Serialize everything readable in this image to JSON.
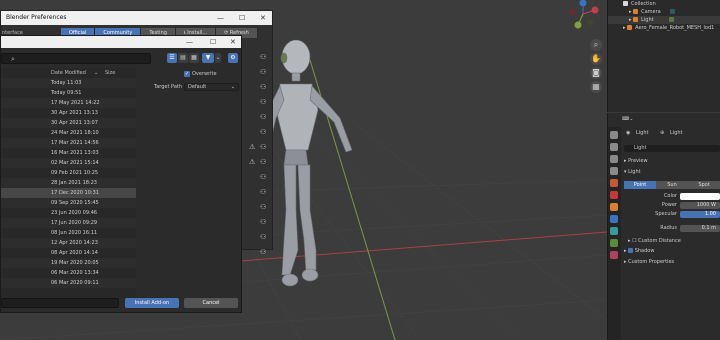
{
  "prefs_window": {
    "title": "Blender Preferences",
    "sidebar_label": "nterface",
    "tabs": [
      {
        "label": "Official",
        "active": true
      },
      {
        "label": "Community",
        "active": true
      },
      {
        "label": "Testing",
        "active": false
      },
      {
        "label": "Install...",
        "active": false
      },
      {
        "label": "Refresh",
        "active": false
      }
    ]
  },
  "file_browser": {
    "columns": {
      "date": "Date Modified",
      "size": "Size"
    },
    "dates": [
      "Today 11:03",
      "Today 09:51",
      "17 May 2021 14:22",
      "30 Apr 2021 13:13",
      "30 Apr 2021 13:07",
      "24 Mar 2021 18:10",
      "17 Mar 2021 14:56",
      "16 Mar 2021 13:03",
      "02 Mar 2021 15:14",
      "09 Feb 2021 10:25",
      "28 Jan 2021 18:23",
      "17 Dec 2020 10:31",
      "09 Sep 2020 15:45",
      "23 Jun 2020 09:46",
      "17 Jun 2020 09:29",
      "08 Jun 2020 16:11",
      "12 Apr 2020 14:23",
      "08 Apr 2020 14:14",
      "19 Mar 2020 20:05",
      "06 Mar 2020 13:34",
      "06 Mar 2020 09:11"
    ],
    "selected_index": 11,
    "overwrite_label": "Overwrite",
    "target_path_label": "Target Path",
    "target_path_value": "Default",
    "install_button": "Install Add-on",
    "cancel_button": "Cancel"
  },
  "outliner": {
    "rows": [
      {
        "label": "Collection",
        "icon_color": "#d9d9d9"
      },
      {
        "label": "Camera",
        "icon_color": "#d9822b"
      },
      {
        "label": "Light",
        "icon_color": "#d9822b"
      },
      {
        "label": "Aero_Female_Robot_MESH_lod1",
        "icon_color": "#d9822b"
      }
    ]
  },
  "properties": {
    "object_name": "Light",
    "data_name": "Light",
    "datablock": "Light",
    "sections": {
      "preview": "Preview",
      "light": "Light",
      "custom_distance": "Custom Distance",
      "shadow": "Shadow",
      "custom_properties": "Custom Properties"
    },
    "light_types": [
      {
        "label": "Point",
        "active": true
      },
      {
        "label": "Sun",
        "active": false
      },
      {
        "label": "Spot",
        "active": false
      }
    ],
    "fields": {
      "color_label": "Color",
      "color_value": "#ffffff",
      "power_label": "Power",
      "power_value": "1000 W",
      "specular_label": "Specular",
      "specular_value": "1.00",
      "radius_label": "Radius",
      "radius_value": "0.1 m"
    }
  },
  "colors": {
    "accent": "#4772b3",
    "x_axis": "#c0404a",
    "y_axis": "#7ea23c"
  }
}
